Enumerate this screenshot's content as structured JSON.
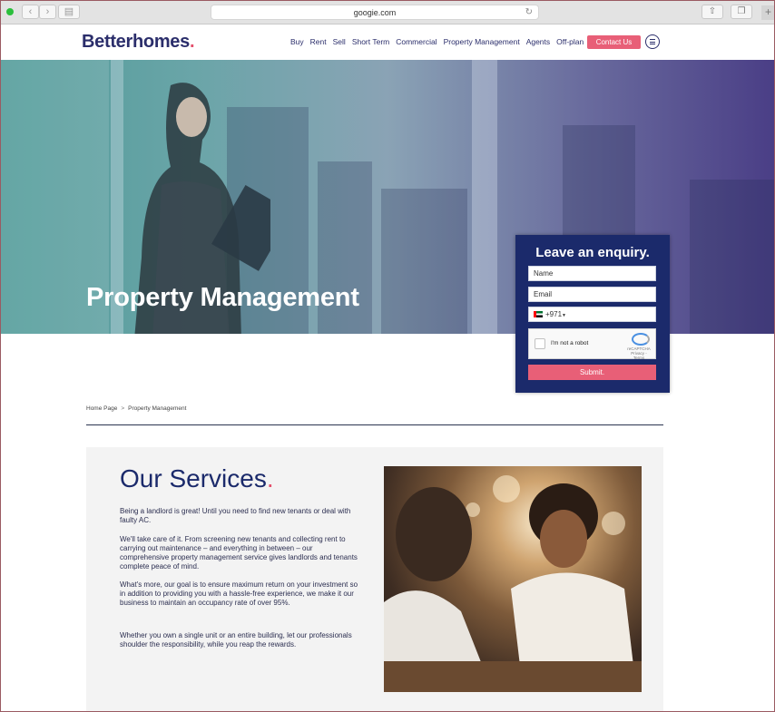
{
  "browser": {
    "url": "googie.com"
  },
  "header": {
    "logo": "Betterhomes",
    "logo_dot": ".",
    "menu": [
      "Buy",
      "Rent",
      "Sell",
      "Short Term",
      "Commercial",
      "Property Management",
      "Agents",
      "Off-plan"
    ],
    "contact_label": "Contact Us"
  },
  "hero": {
    "title": "Property Management"
  },
  "enquiry": {
    "title": "Leave an enquiry.",
    "name_placeholder": "Name",
    "email_placeholder": "Email",
    "phone_code": "+971",
    "captcha_label": "I'm not a robot",
    "captcha_brand": "reCAPTCHA",
    "captcha_links": "Privacy - Terms",
    "submit_label": "Submit."
  },
  "breadcrumb": {
    "home": "Home Page",
    "separator": ">",
    "current": "Property Management"
  },
  "services": {
    "title": "Our Services",
    "title_dot": ".",
    "paragraphs": [
      "Being a landlord is great! Until you need to find new tenants or deal with faulty AC.",
      "We'll take care of it. From screening new tenants and collecting rent to carrying out maintenance – and everything in between – our comprehensive property management service gives landlords and tenants complete peace of mind.",
      "What's more, our goal is to ensure maximum return on your investment so in addition to providing you with a hassle-free experience, we make it our business to maintain an occupancy rate of over 95%.",
      "Whether you own a single unit or an entire building, let our professionals shoulder the responsibility, while you reap the rewards."
    ]
  },
  "colors": {
    "brand_navy": "#1b2a6b",
    "accent_pink": "#e85f77"
  }
}
